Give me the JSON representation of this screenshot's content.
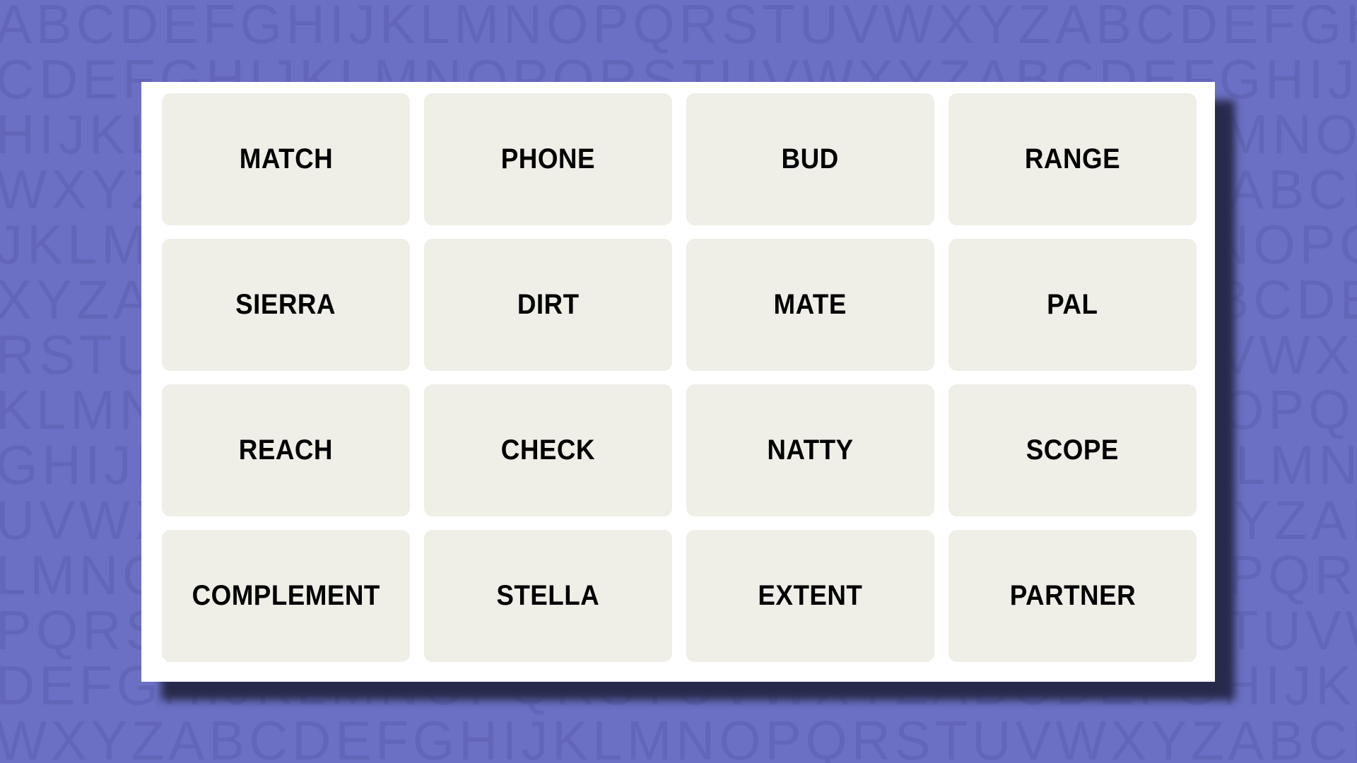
{
  "background": {
    "color": "#6b70c4",
    "letter_rows": [
      "ABCDEFGHIJKLMNOPQRSTUVWXYZABCDEFGHIJ",
      "CDEFGHIJKLMNOPQRSTUVWXYZABCDEFGHIJKL",
      "HIJKLMNOPQRSTUVWXYZABCDEFGHIJKLMNOPQ",
      "WXYZABCDEFGHIJKLMNOPQRSTUVWXYZABCDEF",
      "JKLMNOPQRSTUVWXYZABCDEFGHIJKLMNOPQRS",
      "XYZABCDEFGHIJKLMNOPQRSTUVWXYZABCDEFG",
      "RSTUVWXYZABCDEFGHIJKLMNOPQRSTUVWXYZA",
      "KLMNOPQRSTUVWXYZABCDEFGHIJKLMNOPQRST",
      "GHIJKLMNOPQRSTUVWXYZABCDEFGHIJKLMNOP",
      "UVWXYZABCDEFGHIJKLMNOPQRSTUVWXYZABCD",
      "LMNOPQRSTUVWXYZABCDEFGHIJKLMNOPQRSTU",
      "PQRSTUVWXYZABCDEFGHIJKLMNOPQRSTUVWXY",
      "DEFGHIJKLMNOPQRSTUVWXYZABCDEFGHIJKLM",
      "WXYZABCDEFGHIJKLMNOPQRSTUVWXYZABCDEF"
    ]
  },
  "board": {
    "tiles": [
      "MATCH",
      "PHONE",
      "BUD",
      "RANGE",
      "SIERRA",
      "DIRT",
      "MATE",
      "PAL",
      "REACH",
      "CHECK",
      "NATTY",
      "SCOPE",
      "COMPLEMENT",
      "STELLA",
      "EXTENT",
      "PARTNER"
    ],
    "tile_color": "#efeee7",
    "panel_color": "#ffffff",
    "shadow_color": "#272a4a"
  }
}
